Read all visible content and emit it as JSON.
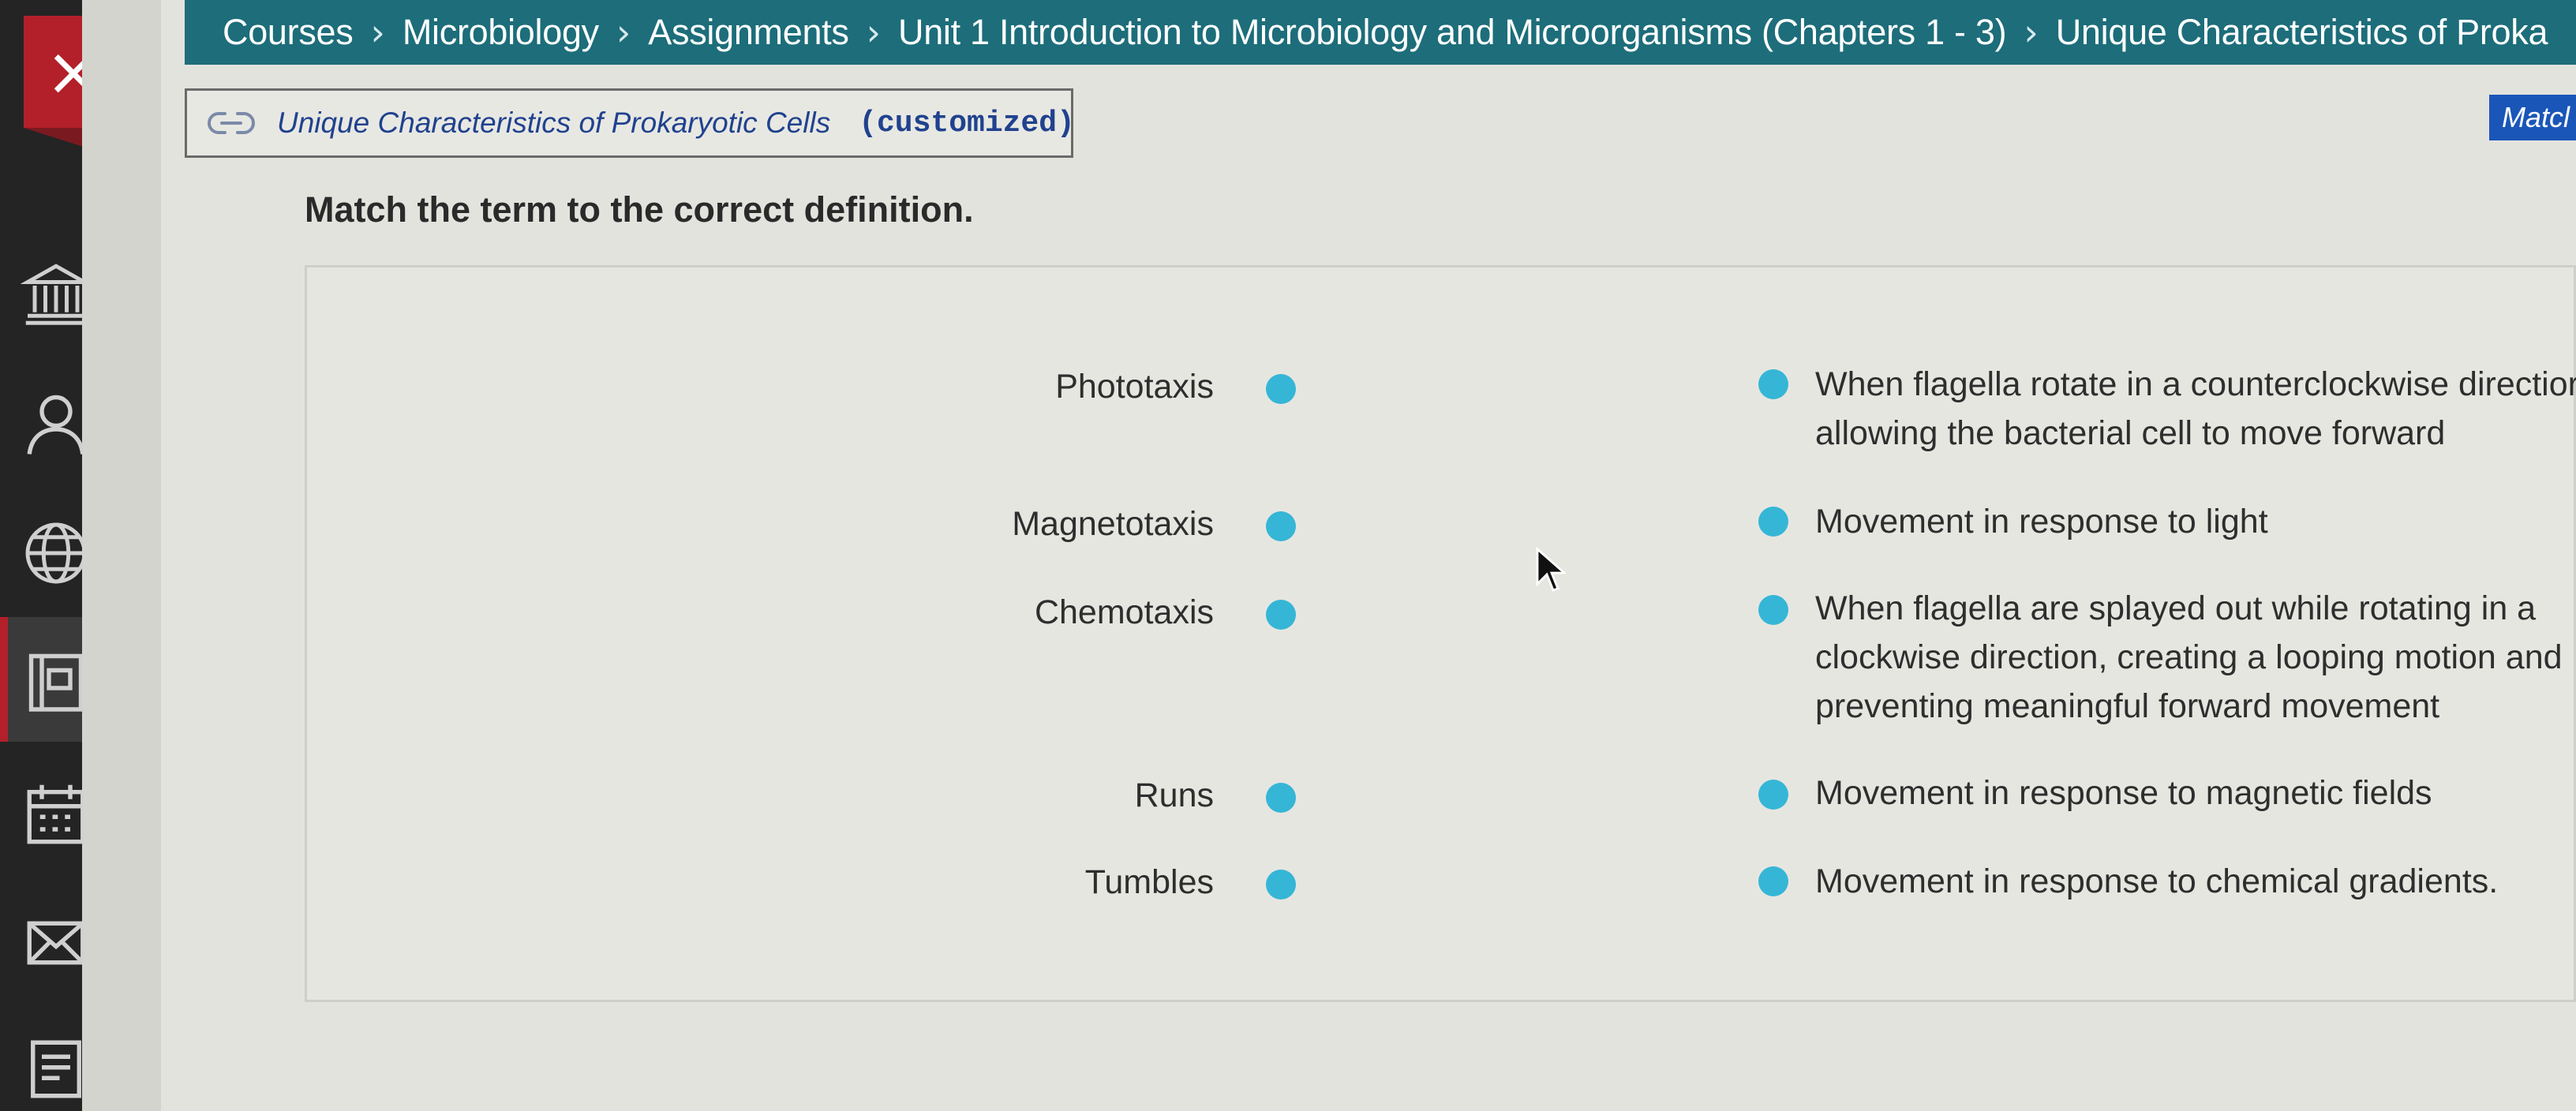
{
  "window": {
    "close_label": "×"
  },
  "breadcrumb": [
    "Courses",
    "Microbiology",
    "Assignments",
    "Unit 1 Introduction to Microbiology and Microorganisms (Chapters 1 - 3)",
    "Unique Characteristics of Proka"
  ],
  "breadcrumb_separator": "›",
  "assignment": {
    "title": "Unique Characteristics of Prokaryotic Cells",
    "suffix": "(customized)",
    "icon": "link-icon"
  },
  "match_button_label": "Matcl",
  "question": {
    "instructions": "Match the term to the correct definition.",
    "terms": [
      "Phototaxis",
      "Magnetotaxis",
      "Chemotaxis",
      "Runs",
      "Tumbles"
    ],
    "definitions": [
      [
        "When flagella rotate in a counterclockwise directior",
        "allowing the bacterial cell to move forward"
      ],
      [
        "Movement in response to light"
      ],
      [
        "When flagella are splayed out while rotating in a",
        "clockwise direction, creating a looping motion and",
        "preventing meaningful forward movement"
      ],
      [
        "Movement in response to magnetic fields"
      ],
      [
        "Movement in response to chemical gradients."
      ]
    ]
  },
  "nav_icons": [
    "institution-icon",
    "user-icon",
    "globe-icon",
    "courses-icon",
    "calendar-icon",
    "inbox-icon",
    "notes-icon"
  ],
  "colors": {
    "breadcrumb_bg": "#1d6d7a",
    "close_button": "#b3202a",
    "match_dot": "#35b6d6",
    "link_text": "#20428e",
    "match_button": "#1a56b8"
  }
}
